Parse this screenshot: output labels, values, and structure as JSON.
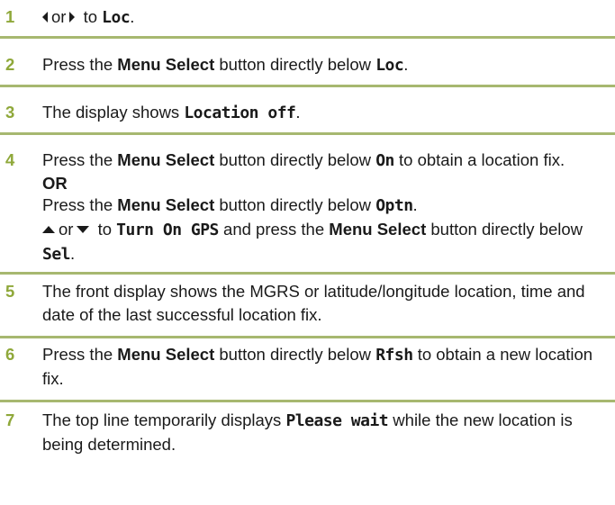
{
  "accent_color": "#8fa83a",
  "rule_color": "#a7b870",
  "steps": [
    {
      "num": "1",
      "or": "or",
      "to": "to",
      "loc": "Loc",
      "end": "."
    },
    {
      "num": "2",
      "a": "Press the",
      "menu": "Menu Select",
      "b": "button directly below",
      "loc": "Loc",
      "end": "."
    },
    {
      "num": "3",
      "a": "The display shows",
      "lcd": "Location off",
      "end": "."
    },
    {
      "num": "4",
      "a": "Press the",
      "menu": "Menu Select",
      "b": "button directly below",
      "on": "On",
      "c": "to obtain a location fix.",
      "or_label": "OR",
      "d": "Press the",
      "menu2": "Menu Select",
      "e": "button directly below",
      "optn": "Optn",
      "end2": ".",
      "or2": "or",
      "to2": "to",
      "turn_on": "Turn On GPS",
      "f": "and press the",
      "menu3": "Menu Select",
      "g": "button directly below",
      "sel": "Sel",
      "end3": "."
    },
    {
      "num": "5",
      "text": "The front display shows the MGRS or latitude/longitude location, time and date of the last successful location fix."
    },
    {
      "num": "6",
      "a": "Press the",
      "menu": "Menu Select",
      "b": "button directly below",
      "rfsh": "Rfsh",
      "c": "to obtain a new location fix."
    },
    {
      "num": "7",
      "a": "The top line temporarily displays",
      "lcd": "Please wait",
      "b": "while the new location is being determined."
    }
  ],
  "icons": [
    "left-arrow-icon",
    "right-arrow-icon",
    "up-arrow-icon",
    "down-arrow-icon"
  ]
}
